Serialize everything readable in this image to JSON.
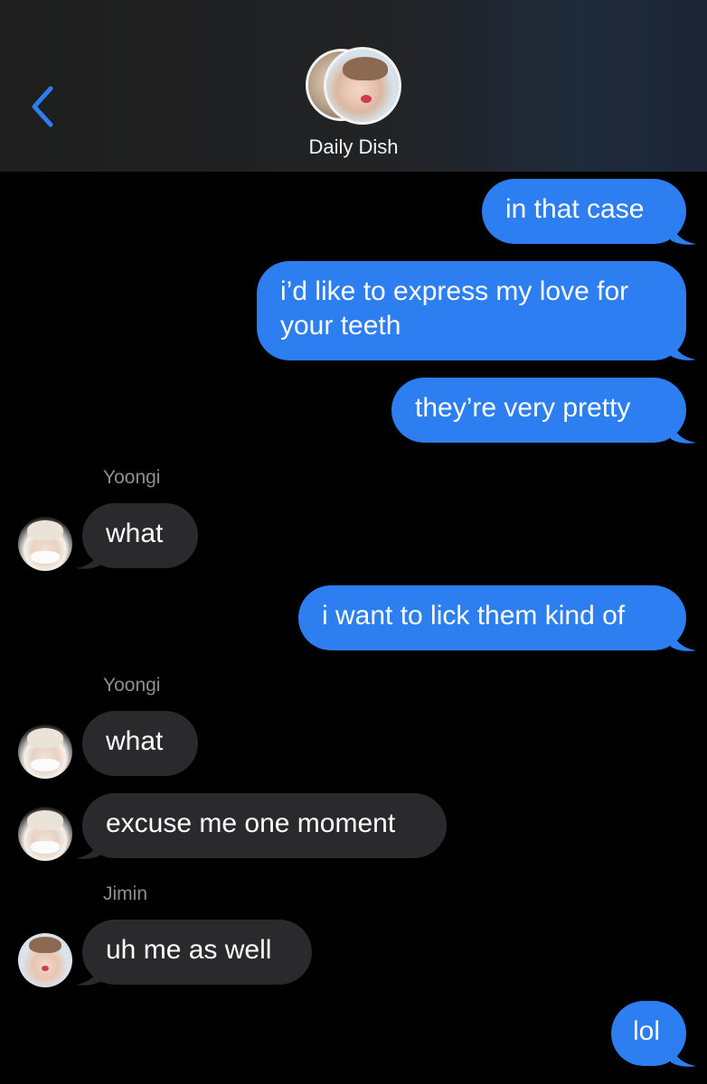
{
  "header": {
    "back_icon": "chevron-left-icon",
    "title": "Daily Dish",
    "accent_color": "#2d7ef0"
  },
  "colors": {
    "sent_bubble": "#2d7ef0",
    "received_bubble": "#2a2a2c",
    "sender_name": "#8e8e93",
    "background": "#000000"
  },
  "messages": [
    {
      "direction": "sent",
      "text": "in that case"
    },
    {
      "direction": "sent",
      "text": "i’d like to express my love for",
      "text_line2": "your teeth"
    },
    {
      "direction": "sent",
      "text": "they’re very pretty"
    },
    {
      "direction": "received",
      "sender": "Yoongi",
      "text": "what"
    },
    {
      "direction": "sent",
      "text": "i want to lick them kind of"
    },
    {
      "direction": "received",
      "sender": "Yoongi",
      "text": "what"
    },
    {
      "direction": "received",
      "text": "excuse me one moment"
    },
    {
      "direction": "received",
      "sender": "Jimin",
      "text": "uh me as well"
    },
    {
      "direction": "sent",
      "text": "lol"
    }
  ]
}
